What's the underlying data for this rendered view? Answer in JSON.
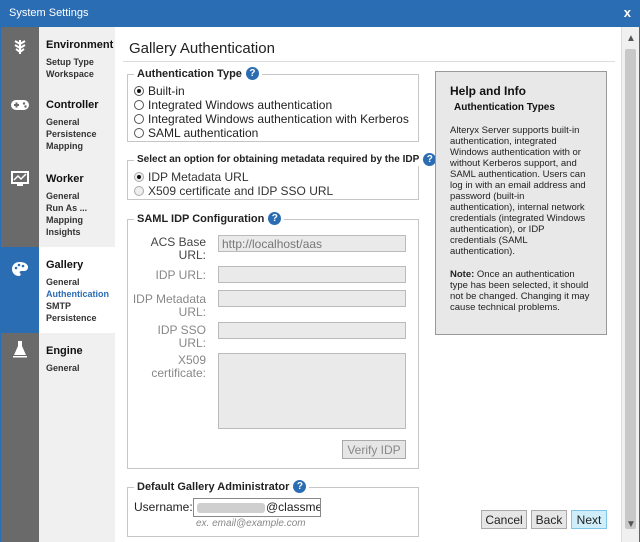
{
  "window": {
    "title": "System Settings",
    "close_glyph": "x"
  },
  "iconbar": {
    "icons": [
      "leaf-icon",
      "gamepad-icon",
      "monitor-icon",
      "palette-icon",
      "flask-icon"
    ]
  },
  "nav": {
    "environment": {
      "title": "Environment",
      "items": [
        "Setup Type",
        "Workspace"
      ]
    },
    "controller": {
      "title": "Controller",
      "items": [
        "General",
        "Persistence",
        "Mapping"
      ]
    },
    "worker": {
      "title": "Worker",
      "items": [
        "General",
        "Run As ...",
        "Mapping",
        "Insights"
      ]
    },
    "gallery": {
      "title": "Gallery",
      "items": [
        "General",
        "Authentication",
        "SMTP",
        "Persistence"
      ],
      "active": "Authentication"
    },
    "engine": {
      "title": "Engine",
      "items": [
        "General"
      ]
    }
  },
  "main": {
    "title": "Gallery Authentication",
    "auth_type": {
      "legend": "Authentication Type",
      "help": "?",
      "options": [
        "Built-in",
        "Integrated Windows authentication",
        "Integrated Windows authentication with Kerberos",
        "SAML authentication"
      ],
      "selected": "Built-in"
    },
    "metadata": {
      "legend": "Select an option for obtaining metadata required by the IDP",
      "help": "?",
      "options": [
        "IDP Metadata URL",
        "X509 certificate and IDP SSO URL"
      ],
      "selected": "IDP Metadata URL"
    },
    "saml": {
      "legend": "SAML IDP Configuration",
      "help": "?",
      "acs_label": "ACS Base URL:",
      "acs_value": "http://localhost/aas",
      "idp_url_label": "IDP URL:",
      "idp_metadata_label": "IDP Metadata URL:",
      "idp_sso_label": "IDP SSO URL:",
      "x509_label": "X509 certificate:",
      "verify_button": "Verify IDP"
    },
    "admin": {
      "legend": "Default Gallery Administrator",
      "help": "?",
      "username_label": "Username:",
      "username_value": "@classmet",
      "hint": "ex. email@example.com"
    },
    "help_box": {
      "title": "Help and Info",
      "subtitle": "Authentication Types",
      "body": "Alteryx Server supports built-in authentication, integrated Windows authentication with or without Kerberos support, and SAML authentication. Users can log in with an email address and password (built-in authentication), internal network credentials (integrated Windows authentication), or IDP credentials (SAML authentication).",
      "note_label": "Note:",
      "note": " Once an authentication type has been selected, it should not be changed. Changing it may cause technical problems."
    },
    "buttons": {
      "cancel": "Cancel",
      "back": "Back",
      "next": "Next"
    }
  },
  "scrollbar": {
    "up": "▲",
    "down": "▼"
  }
}
